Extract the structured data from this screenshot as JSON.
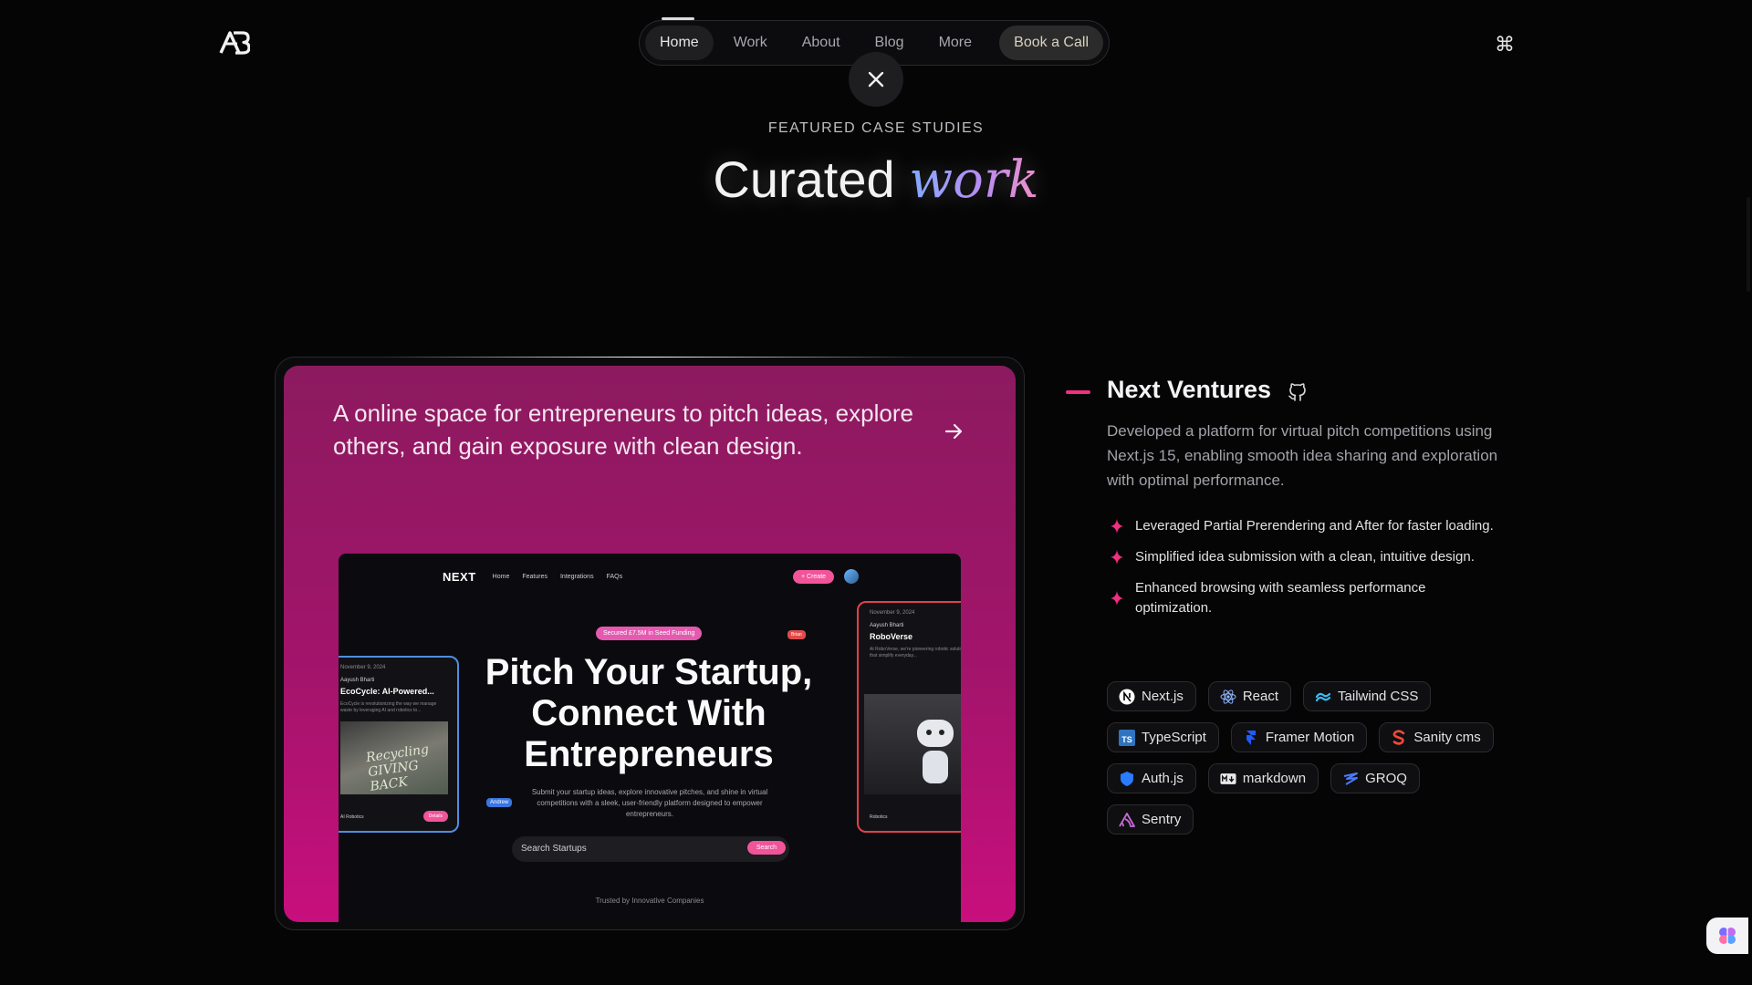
{
  "header": {
    "logo_text": "AB",
    "nav": [
      {
        "label": "Home"
      },
      {
        "label": "Work"
      },
      {
        "label": "About"
      },
      {
        "label": "Blog"
      },
      {
        "label": "More"
      },
      {
        "label": "Book a Call"
      }
    ],
    "active_nav": "Home",
    "close_icon": "close-icon",
    "command_icon": "command-icon"
  },
  "section": {
    "eyebrow": "FEATURED CASE STUDIES",
    "title_plain": "Curated",
    "title_accent": "work"
  },
  "project": {
    "card_tagline": "A online space for entrepreneurs to pitch ideas, explore others, and gain exposure with clean design.",
    "card_color": "#a3146b",
    "accent_color": "#ef2f7f",
    "name": "Next Ventures",
    "description": "Developed a platform for virtual pitch competitions using Next.js 15, enabling smooth idea sharing and exploration with optimal performance.",
    "bullets": [
      "Leveraged Partial Prerendering and After for faster loading.",
      "Simplified idea submission with a clean, intuitive design.",
      "Enhanced browsing with seamless performance optimization."
    ],
    "tech": [
      {
        "label": "Next.js",
        "icon": "nextjs-icon"
      },
      {
        "label": "React",
        "icon": "react-icon"
      },
      {
        "label": "Tailwind CSS",
        "icon": "tailwind-icon"
      },
      {
        "label": "TypeScript",
        "icon": "typescript-icon"
      },
      {
        "label": "Framer Motion",
        "icon": "framer-icon"
      },
      {
        "label": "Sanity cms",
        "icon": "sanity-icon"
      },
      {
        "label": "Auth.js",
        "icon": "authjs-icon"
      },
      {
        "label": "markdown",
        "icon": "markdown-icon"
      },
      {
        "label": "GROQ",
        "icon": "groq-icon"
      },
      {
        "label": "Sentry",
        "icon": "sentry-icon"
      }
    ]
  },
  "mockup": {
    "brand": "NEXT",
    "nav": [
      "Home",
      "Features",
      "Integrations",
      "FAQs"
    ],
    "create_label": "+ Create",
    "badge": "Secured £7.5M in Seed Funding",
    "brian_tag": "Brian",
    "andrew_tag": "Andrew",
    "headline": "Pitch Your Startup, Connect With Entrepreneurs",
    "subtext": "Submit your startup ideas, explore innovative pitches, and shine in virtual competitions with a sleek, user-friendly platform designed to empower entrepreneurs.",
    "search_placeholder": "Search Startups",
    "search_button": "Search",
    "trusted": "Trusted by Innovative Companies",
    "left_card": {
      "date": "November 9, 2024",
      "author": "Aayush Bharti",
      "title": "EcoCycle: AI-Powered...",
      "desc": "EcoCycle is revolutionizing the way we manage waste by leveraging AI and robotics to...",
      "image_text": "Recycling GIVING BACK",
      "tag": "AI Robotics",
      "button": "Details"
    },
    "right_card": {
      "date": "November 9, 2024",
      "author": "Aayush Bharti",
      "title": "RoboVerse",
      "desc": "At RoboVerse, we're pioneering robotic solutions that simplify everyday...",
      "tag": "Robotics"
    }
  }
}
